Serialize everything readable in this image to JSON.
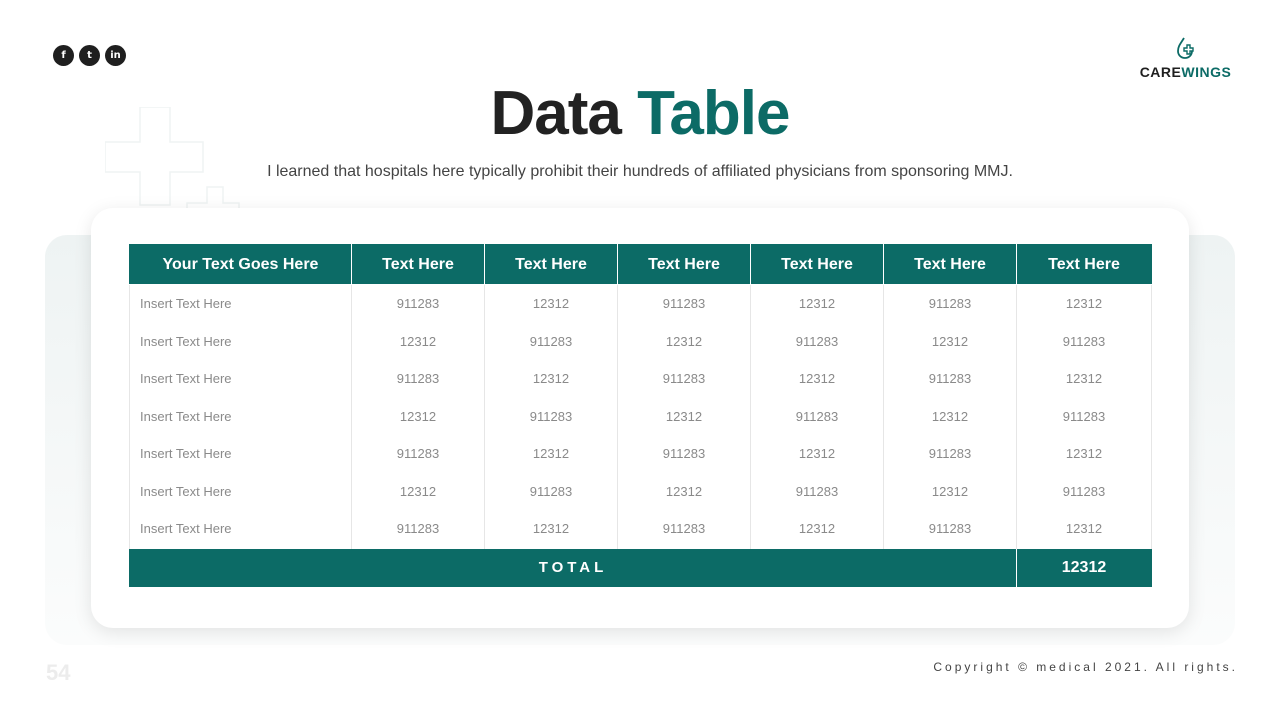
{
  "social": [
    {
      "name": "facebook-icon",
      "glyph": "f"
    },
    {
      "name": "twitter-icon",
      "glyph": "t"
    },
    {
      "name": "linkedin-icon",
      "glyph": "in"
    }
  ],
  "logo": {
    "part1": "CARE",
    "part2": "WINGS",
    "icon": "medical-drop-cross-icon"
  },
  "title": {
    "part1": "Data",
    "part2": "Table"
  },
  "subtitle": "I learned that hospitals here typically prohibit their hundreds of affiliated physicians from sponsoring MMJ.",
  "colors": {
    "accent": "#0c6b66",
    "dark": "#222222",
    "muted_text": "#8a8a8a"
  },
  "table": {
    "headers": [
      "Your Text Goes Here",
      "Text Here",
      "Text Here",
      "Text Here",
      "Text Here",
      "Text Here",
      "Text Here"
    ],
    "rows": [
      [
        "Insert Text Here",
        "911283",
        "12312",
        "911283",
        "12312",
        "911283",
        "12312"
      ],
      [
        "Insert Text Here",
        "12312",
        "911283",
        "12312",
        "911283",
        "12312",
        "911283"
      ],
      [
        "Insert Text Here",
        "911283",
        "12312",
        "911283",
        "12312",
        "911283",
        "12312"
      ],
      [
        "Insert Text Here",
        "12312",
        "911283",
        "12312",
        "911283",
        "12312",
        "911283"
      ],
      [
        "Insert Text Here",
        "911283",
        "12312",
        "911283",
        "12312",
        "911283",
        "12312"
      ],
      [
        "Insert Text Here",
        "12312",
        "911283",
        "12312",
        "911283",
        "12312",
        "911283"
      ],
      [
        "Insert Text Here",
        "911283",
        "12312",
        "911283",
        "12312",
        "911283",
        "12312"
      ]
    ],
    "total_label": "TOTAL",
    "total_value": "12312"
  },
  "page_number": "54",
  "copyright": "Copyright © medical 2021. All rights."
}
